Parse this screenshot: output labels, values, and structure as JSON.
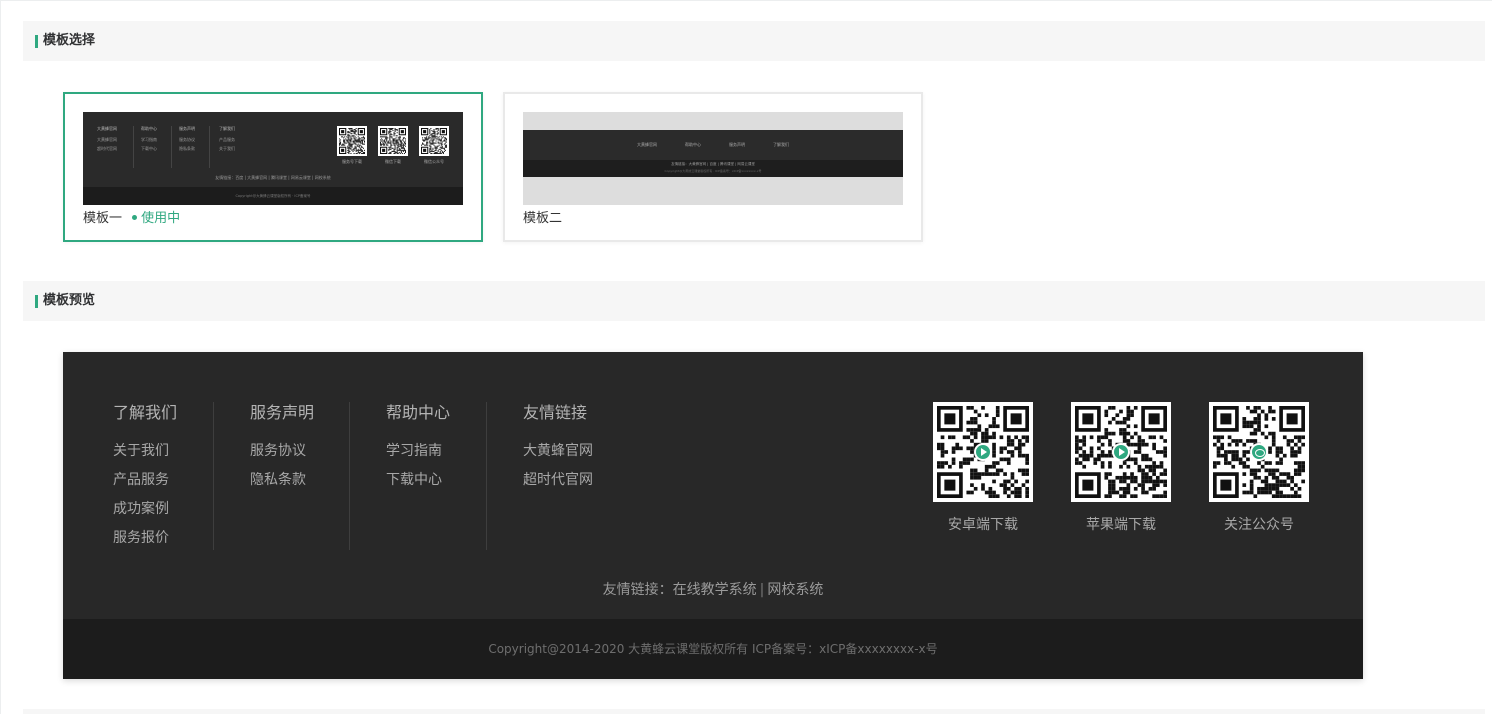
{
  "sections": {
    "template_select": "模板选择",
    "template_preview": "模板预览"
  },
  "templates": [
    {
      "name": "模板一",
      "status": "使用中",
      "thumb": {
        "cols": [
          {
            "head": "大黄蜂官网",
            "items": [
              "大黄蜂官网",
              "超时代官网"
            ]
          },
          {
            "head": "帮助中心",
            "items": [
              "学习指南",
              "下载中心"
            ]
          },
          {
            "head": "服务声明",
            "items": [
              "服务协议",
              "隐私条款"
            ]
          },
          {
            "head": "了解我们",
            "items": [
              "产品服务",
              "关于我们"
            ]
          }
        ],
        "qr_labels": [
          "服务号下载",
          "微信下载",
          "微信公众号"
        ],
        "links": "友情链接：百度 | 大黄蜂官网 | 腾讯课堂 | 网易云课堂 | 网校系统",
        "copyright": "Copyright@大黄蜂云课堂版权所有 · ICP备案号"
      }
    },
    {
      "name": "模板二",
      "status": "",
      "thumb": {
        "nav": [
          "大黄蜂官网",
          "帮助中心",
          "服务声明",
          "了解我们"
        ],
        "row1": "友情链接：大黄蜂官网 | 百度 | 腾讯课堂 | 网易云课堂",
        "row2": "Copyright@大黄蜂云课堂版权所有 · ICP备案号：xICP备xxxxxxxx-x号"
      }
    }
  ],
  "preview": {
    "columns": [
      {
        "head": "了解我们",
        "items": [
          "关于我们",
          "产品服务",
          "成功案例",
          "服务报价"
        ]
      },
      {
        "head": "服务声明",
        "items": [
          "服务协议",
          "隐私条款"
        ]
      },
      {
        "head": "帮助中心",
        "items": [
          "学习指南",
          "下载中心"
        ]
      },
      {
        "head": "友情链接",
        "items": [
          "大黄蜂官网",
          "超时代官网"
        ]
      }
    ],
    "qr_codes": [
      {
        "label": "安卓端下载",
        "icon": "play-icon"
      },
      {
        "label": "苹果端下载",
        "icon": "play-icon"
      },
      {
        "label": "关注公众号",
        "icon": "wechat-icon"
      }
    ],
    "links_prefix": "友情链接：",
    "links": [
      "在线教学系统",
      "网校系统"
    ],
    "links_sep": "|",
    "copyright": "Copyright@2014-2020 大黄蜂云课堂版权所有  ICP备案号：xICP备xxxxxxxx-x号"
  },
  "colors": {
    "accent": "#2fa880",
    "footer_bg": "#282828",
    "footer_bottom": "#1c1c1c"
  }
}
